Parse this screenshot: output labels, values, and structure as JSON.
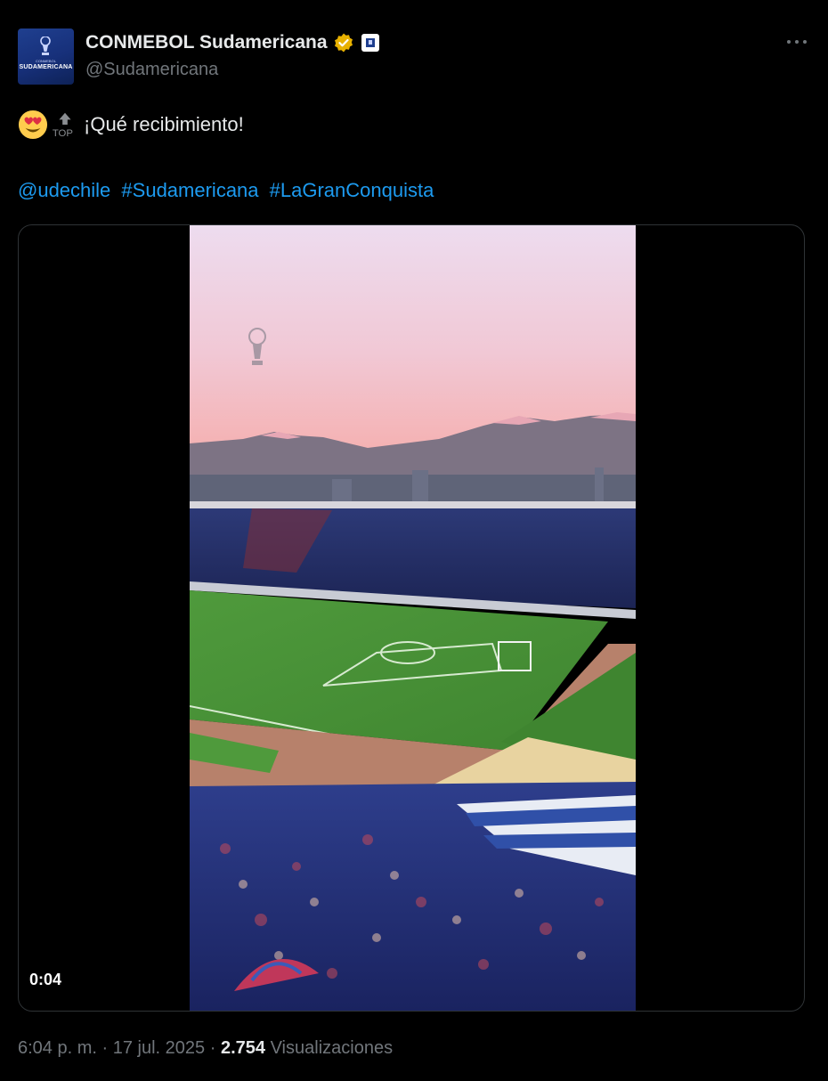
{
  "account": {
    "display_name": "CONMEBOL Sudamericana",
    "handle": "@Sudamericana",
    "avatar_label": "SUDAMERICANA",
    "avatar_sublabel": "CONMEBOL"
  },
  "icons": {
    "verified": "verified-gold-check-icon",
    "affiliate": "affiliate-badge-icon",
    "more": "more-dots-icon",
    "heart_eyes": "heart-eyes-emoji-icon",
    "top": "top-arrow-emoji-icon",
    "trophy": "trophy-watermark-icon"
  },
  "tweet": {
    "text": "¡Qué recibimiento!",
    "links": [
      "@udechile",
      "#Sudamericana",
      "#LaGranConquista"
    ]
  },
  "media": {
    "duration": "0:04"
  },
  "meta": {
    "time": "6:04 p. m.",
    "separator": "·",
    "date": "17 jul. 2025",
    "views_count": "2.754",
    "views_label": "Visualizaciones"
  },
  "colors": {
    "link": "#1d9bf0",
    "secondary_text": "#71767b",
    "verified": "#e8b100"
  }
}
